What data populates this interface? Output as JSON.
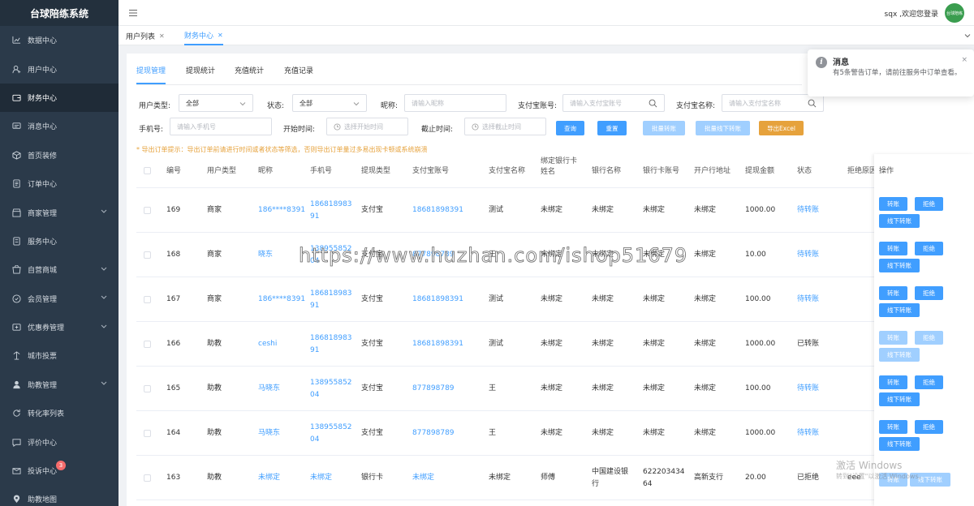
{
  "app": {
    "title": "台球陪练系统",
    "welcome": "sqx ,欢迎您登录",
    "avatar_text": "台球陪练",
    "accent": "#409eff"
  },
  "sidebar": {
    "items": [
      {
        "label": "数据中心",
        "icon": "chart-icon"
      },
      {
        "label": "用户中心",
        "icon": "user-icon"
      },
      {
        "label": "财务中心",
        "icon": "wallet-icon",
        "active": true
      },
      {
        "label": "消息中心",
        "icon": "message-icon"
      },
      {
        "label": "首页装修",
        "icon": "box-icon"
      },
      {
        "label": "订单中心",
        "icon": "order-icon"
      },
      {
        "label": "商家管理",
        "icon": "shop-icon",
        "expandable": true
      },
      {
        "label": "服务中心",
        "icon": "service-icon"
      },
      {
        "label": "自营商城",
        "icon": "mall-icon",
        "expandable": true
      },
      {
        "label": "会员管理",
        "icon": "member-icon",
        "expandable": true
      },
      {
        "label": "优惠券管理",
        "icon": "coupon-icon",
        "expandable": true
      },
      {
        "label": "城市投票",
        "icon": "vote-icon"
      },
      {
        "label": "助教管理",
        "icon": "assistant-icon",
        "expandable": true
      },
      {
        "label": "转化率列表",
        "icon": "refresh-icon"
      },
      {
        "label": "评价中心",
        "icon": "comment-icon"
      },
      {
        "label": "投诉中心",
        "icon": "complaint-icon",
        "badge": "3"
      },
      {
        "label": "助教地图",
        "icon": "location-icon"
      }
    ]
  },
  "tabs": [
    {
      "label": "用户列表",
      "active": false
    },
    {
      "label": "财务中心",
      "active": true
    }
  ],
  "subtabs": [
    "提现管理",
    "提现统计",
    "充值统计",
    "充值记录"
  ],
  "filters": {
    "user_type_label": "用户类型:",
    "user_type_value": "全部",
    "status_label": "状态:",
    "status_value": "全部",
    "nickname_label": "昵称:",
    "nickname_placeholder": "请输入昵称",
    "alipay_account_label": "支付宝账号:",
    "alipay_account_placeholder": "请输入支付宝账号",
    "alipay_name_label": "支付宝名称:",
    "alipay_name_placeholder": "请输入支付宝名称",
    "phone_label": "手机号:",
    "phone_placeholder": "请输入手机号",
    "start_label": "开始时间:",
    "start_placeholder": "选择开始时间",
    "end_label": "截止时间:",
    "end_placeholder": "选择截止时间"
  },
  "buttons": {
    "query": "查询",
    "reset": "重置",
    "batch_transfer": "批量转账",
    "batch_offline": "批量线下转账",
    "export": "导出Excel"
  },
  "tip": "* 导出订单提示：导出订单前请进行时间或者状态等筛选，否则导出订单量过多易出现卡顿或系统崩溃",
  "table": {
    "headers": [
      "编号",
      "用户类型",
      "昵称",
      "手机号",
      "提现类型",
      "支付宝账号",
      "支付宝名称",
      "绑定银行卡姓名",
      "银行名称",
      "银行卡账号",
      "开户行地址",
      "提现金额",
      "状态",
      "拒绝原因",
      "操作"
    ],
    "rows": [
      {
        "id": "169",
        "type": "商家",
        "nick": "186****8391",
        "phone": "18681898391",
        "wtype": "支付宝",
        "account": "18681898391",
        "aname": "测试",
        "cardname": "未绑定",
        "bank": "未绑定",
        "card": "未绑定",
        "addr": "未绑定",
        "amount": "1000.00",
        "status": "待转账",
        "ops": [
          "转账",
          "拒绝",
          "线下转账"
        ],
        "enabled": true
      },
      {
        "id": "168",
        "type": "商家",
        "nick": "晓东",
        "phone": "13895585204",
        "wtype": "支付宝",
        "account": "877898789",
        "aname": "王",
        "cardname": "未绑定",
        "bank": "未绑定",
        "card": "未绑定",
        "addr": "未绑定",
        "amount": "10.00",
        "status": "待转账",
        "ops": [
          "转账",
          "拒绝",
          "线下转账"
        ],
        "enabled": true
      },
      {
        "id": "167",
        "type": "商家",
        "nick": "186****8391",
        "phone": "18681898391",
        "wtype": "支付宝",
        "account": "18681898391",
        "aname": "测试",
        "cardname": "未绑定",
        "bank": "未绑定",
        "card": "未绑定",
        "addr": "未绑定",
        "amount": "100.00",
        "status": "待转账",
        "ops": [
          "转账",
          "拒绝",
          "线下转账"
        ],
        "enabled": true
      },
      {
        "id": "166",
        "type": "助教",
        "nick": "ceshi",
        "phone": "18681898391",
        "wtype": "支付宝",
        "account": "18681898391",
        "aname": "测试",
        "cardname": "未绑定",
        "bank": "未绑定",
        "card": "未绑定",
        "addr": "未绑定",
        "amount": "1000.00",
        "status": "已转账",
        "ops": [
          "转账",
          "拒绝",
          "线下转账"
        ],
        "enabled": false
      },
      {
        "id": "165",
        "type": "助教",
        "nick": "马晓东",
        "phone": "13895585204",
        "wtype": "支付宝",
        "account": "877898789",
        "aname": "王",
        "cardname": "未绑定",
        "bank": "未绑定",
        "card": "未绑定",
        "addr": "未绑定",
        "amount": "100.00",
        "status": "待转账",
        "ops": [
          "转账",
          "拒绝",
          "线下转账"
        ],
        "enabled": true
      },
      {
        "id": "164",
        "type": "助教",
        "nick": "马晓东",
        "phone": "13895585204",
        "wtype": "支付宝",
        "account": "877898789",
        "aname": "王",
        "cardname": "未绑定",
        "bank": "未绑定",
        "card": "未绑定",
        "addr": "未绑定",
        "amount": "1000.00",
        "status": "待转账",
        "ops": [
          "转账",
          "拒绝",
          "线下转账"
        ],
        "enabled": true
      },
      {
        "id": "163",
        "type": "助教",
        "nick": "未绑定",
        "phone": "未绑定",
        "wtype": "银行卡",
        "account": "未绑定",
        "aname": "未绑定",
        "cardname": "师傅",
        "bank": "中国建设银行",
        "card": "62220343464",
        "addr": "高新支行",
        "amount": "20.00",
        "status": "已拒绝",
        "reason": "eee",
        "ops": [
          "转账",
          "线下转账"
        ],
        "enabled": false
      }
    ]
  },
  "notification": {
    "title": "消息",
    "message": "有5条警告订单，请前往服务中订单查看。",
    "close": "×"
  },
  "watermark": "https://www.huzhan.com/ishop51679",
  "windows_watermark": {
    "line1": "激活 Windows",
    "line2": "转到\"设置\"以激活 Windows。"
  }
}
